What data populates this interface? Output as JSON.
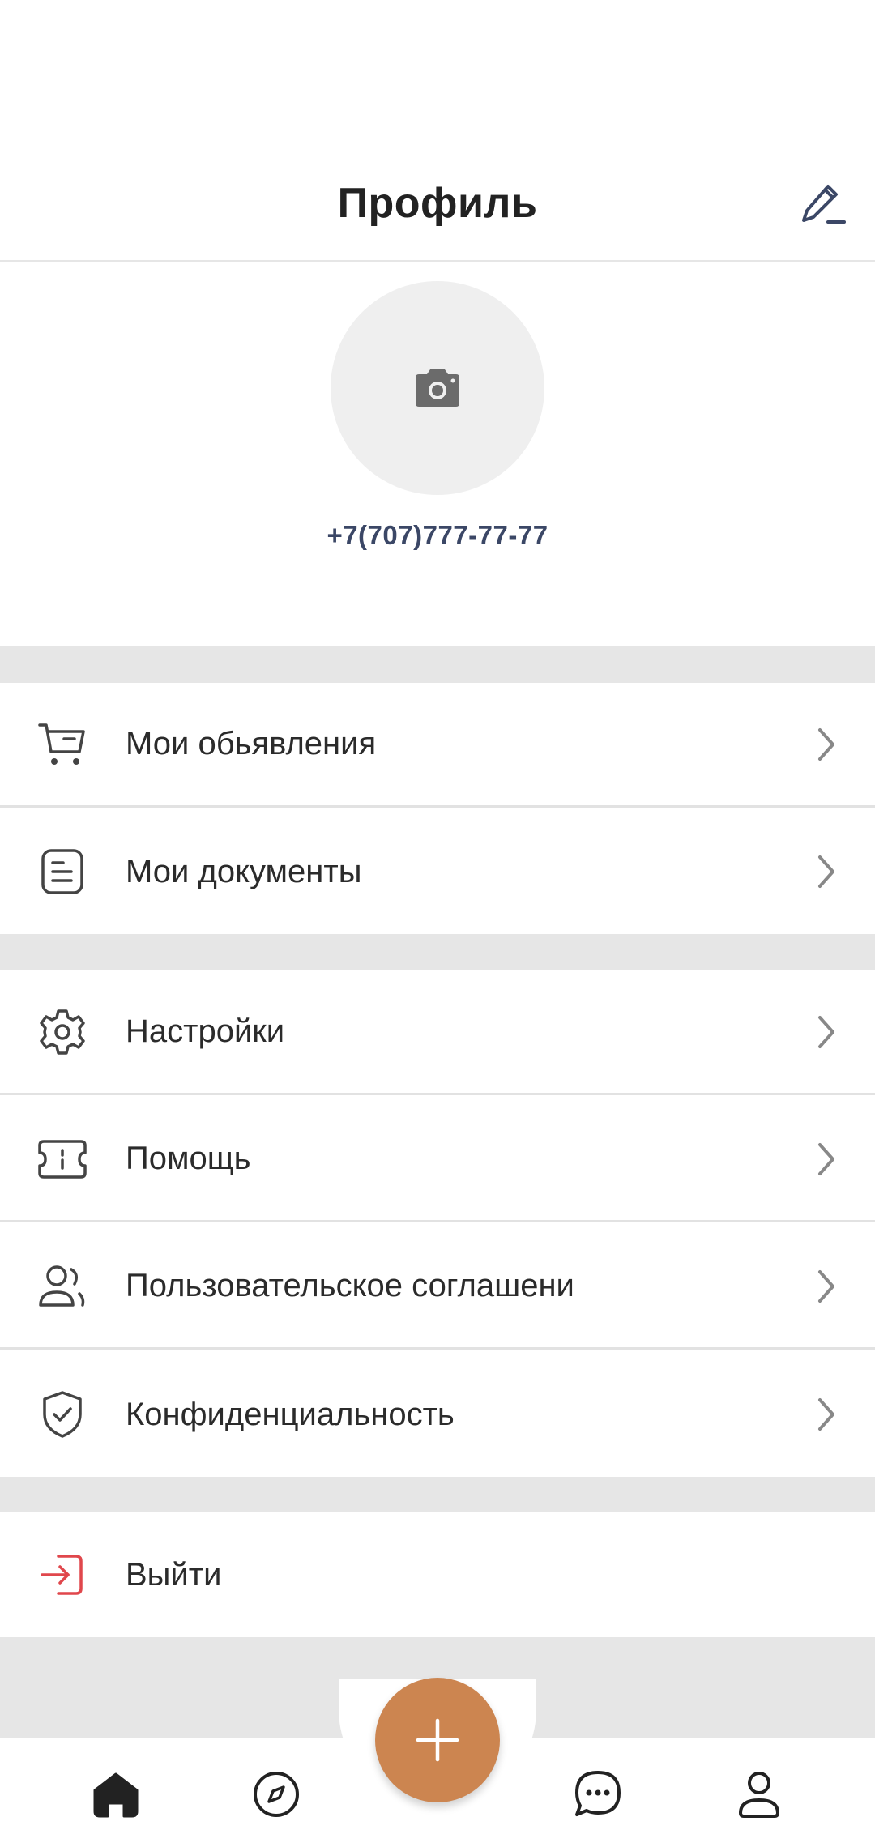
{
  "header": {
    "title": "Профиль"
  },
  "profile": {
    "phone": "+7(707)777-77-77"
  },
  "menu": {
    "ads": "Мои обьявления",
    "documents": "Мои документы",
    "settings": "Настройки",
    "help": "Помощь",
    "agreement": "Пользовательское соглашени",
    "privacy": "Конфиденциальность",
    "logout": "Выйти"
  },
  "colors": {
    "accent": "#cc8550",
    "logout_icon": "#e0474c",
    "icon_gray": "#444444",
    "section_gap": "#e6e6e6",
    "phone_text": "#3b4766"
  },
  "icons": {
    "edit": "pencil-icon",
    "avatar": "camera-icon",
    "ads": "cart-icon",
    "documents": "document-icon",
    "settings": "gear-icon",
    "help": "ticket-icon",
    "agreement": "users-icon",
    "privacy": "shield-check-icon",
    "logout": "logout-icon",
    "chevron": "chevron-right-icon",
    "tabs": [
      "home-icon",
      "compass-icon",
      "plus-icon",
      "chat-icon",
      "profile-icon"
    ]
  },
  "tabbar": {
    "active": "home"
  }
}
